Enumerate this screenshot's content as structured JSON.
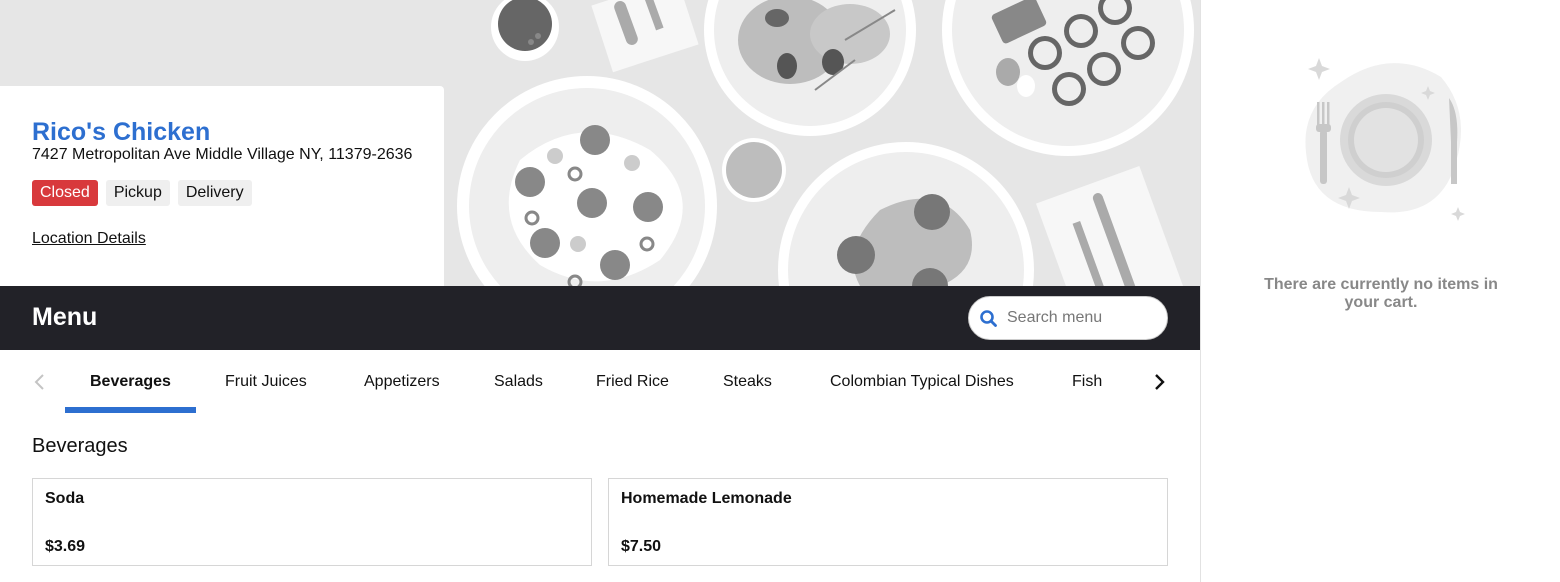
{
  "restaurant": {
    "name": "Rico's Chicken",
    "address": "7427 Metropolitan Ave Middle Village NY, 11379-2636",
    "badges": {
      "status": "Closed",
      "pickup": "Pickup",
      "delivery": "Delivery"
    },
    "location_link": "Location Details"
  },
  "menu": {
    "title": "Menu",
    "search_placeholder": "Search menu"
  },
  "tabs": [
    {
      "label": "Beverages",
      "active": true
    },
    {
      "label": "Fruit Juices"
    },
    {
      "label": "Appetizers"
    },
    {
      "label": "Salads"
    },
    {
      "label": "Fried Rice"
    },
    {
      "label": "Steaks"
    },
    {
      "label": "Colombian Typical Dishes"
    },
    {
      "label": "Fish"
    }
  ],
  "section": {
    "title": "Beverages",
    "items": [
      {
        "name": "Soda",
        "price": "$3.69"
      },
      {
        "name": "Homemade Lemonade",
        "price": "$7.50"
      }
    ]
  },
  "cart": {
    "empty_message": "There are currently no items in your cart."
  },
  "colors": {
    "accent": "#2d6fd0",
    "closed_badge": "#d8393c",
    "menu_bar": "#222228"
  },
  "icons": [
    "search-icon",
    "chevron-left-icon",
    "chevron-right-icon",
    "empty-plate-icon"
  ]
}
